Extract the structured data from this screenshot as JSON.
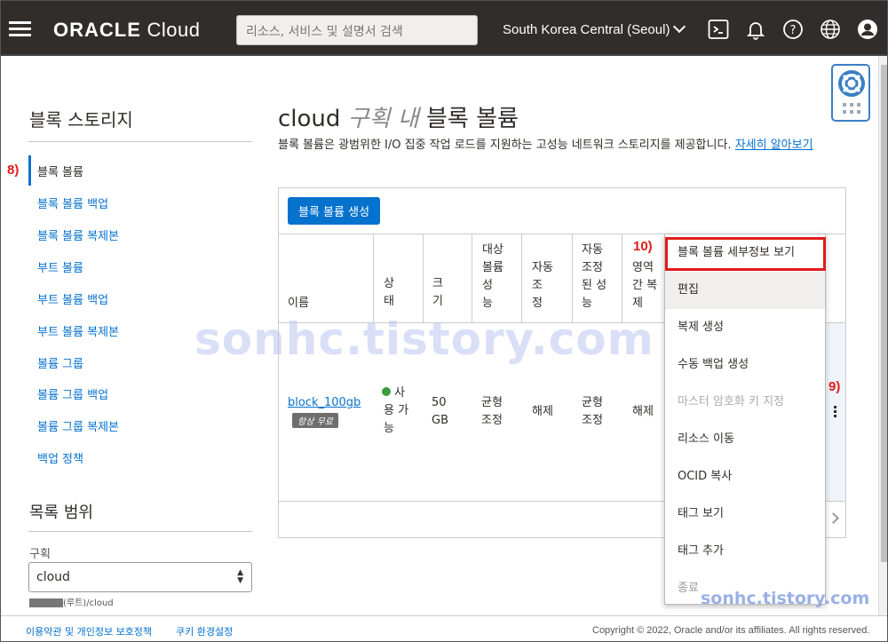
{
  "topbar": {
    "logo_bold": "ORACLE",
    "logo_light": "Cloud",
    "search_placeholder": "리소스, 서비스 및 설명서 검색",
    "region": "South Korea Central (Seoul)",
    "icons": [
      "menu-icon",
      "cloud-shell-icon",
      "bell-icon",
      "help-icon",
      "globe-icon",
      "profile-icon"
    ]
  },
  "sidebar": {
    "title": "블록 스토리지",
    "items": [
      {
        "label": "블록 볼륨",
        "active": true
      },
      {
        "label": "블록 볼륨 백업"
      },
      {
        "label": "블록 볼륨 복제본"
      },
      {
        "label": "부트 볼륨"
      },
      {
        "label": "부트 볼륨 백업"
      },
      {
        "label": "부트 볼륨 복제본"
      },
      {
        "label": "볼륨 그룹"
      },
      {
        "label": "볼륨 그룹 백업"
      },
      {
        "label": "볼륨 그룹 복제본"
      },
      {
        "label": "백업 정책"
      }
    ],
    "scope_title": "목록 범위",
    "compartment_label": "구획",
    "compartment_value": "cloud",
    "compartment_path": "(루트)/cloud"
  },
  "main": {
    "title_prefix": "cloud",
    "title_italic": "구획 내",
    "title_suffix": "블록 볼륨",
    "description": "블록 볼륨은 광범위한 I/O 집중 작업 로드를 지원하는 고성능 네트워크 스토리지를 제공합니다. ",
    "learn_more": "자세히 알아보기",
    "create_button": "블록 볼륨 생성",
    "columns": {
      "name": "이름",
      "status": [
        "상",
        "태"
      ],
      "size": [
        "크",
        "기"
      ],
      "target_perf": [
        "대상",
        "볼륨",
        "성",
        "능"
      ],
      "auto_tune": [
        "자동",
        "조",
        "정"
      ],
      "auto_tuned_perf": [
        "자동",
        "조정",
        "된 성",
        "능"
      ],
      "cross_region": [
        "영역",
        "간 복",
        "제"
      ]
    },
    "row": {
      "name": "block_100gb",
      "badge": "항상 무료",
      "status": [
        "사",
        "용 가",
        "능"
      ],
      "size": [
        "50",
        "GB"
      ],
      "target_perf": [
        "균형",
        "조정"
      ],
      "auto_tune": "해제",
      "auto_tuned_perf": [
        "균형",
        "조정"
      ],
      "cross_region": "해제"
    }
  },
  "menu": {
    "items": [
      {
        "label": "블록 볼륨 세부정보 보기",
        "state": "highlighted"
      },
      {
        "label": "편집",
        "state": "hover"
      },
      {
        "label": "복제 생성"
      },
      {
        "label": "수동 백업 생성"
      },
      {
        "label": "마스터 암호화 키 지정",
        "state": "disabled"
      },
      {
        "label": "리소스 이동"
      },
      {
        "label": "OCID 복사"
      },
      {
        "label": "태그 보기"
      },
      {
        "label": "태그 추가"
      },
      {
        "label": "종료",
        "state": "disabled"
      }
    ]
  },
  "annotations": {
    "step8": "8)",
    "step9": "9)",
    "step10": "10)"
  },
  "watermark": {
    "big": "sonhc.tistory.com",
    "small": "sonhc.tistory.com"
  },
  "footer": {
    "terms": "이용약관 및 개인정보 보호정책",
    "cookies": "쿠키 환경설정",
    "copyright": "Copyright © 2022, Oracle and/or its affiliates. All rights reserved."
  },
  "colors": {
    "topbar": "#312d2a",
    "accent": "#0572ce",
    "annotation": "#e11a1a",
    "status_ok": "#3a9d40"
  }
}
